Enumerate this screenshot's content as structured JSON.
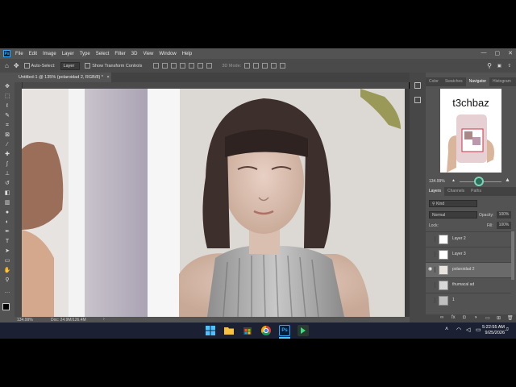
{
  "app": {
    "ps_logo": "Ps",
    "menu": [
      "File",
      "Edit",
      "Image",
      "Layer",
      "Type",
      "Select",
      "Filter",
      "3D",
      "View",
      "Window",
      "Help"
    ],
    "window_controls": [
      "—",
      "▢",
      "✕"
    ]
  },
  "options_bar": {
    "auto_select_label": "Auto-Select:",
    "auto_select_target": "Layer",
    "transform_label": "Show Transform Controls",
    "mode_3d": "3D Mode:"
  },
  "document": {
    "tab_title": "Untitled-1 @ 135% (polaroidad 2, RGB/8) *",
    "tab_close": "×"
  },
  "status_bar": {
    "zoom": "134.99%",
    "doc_size": "Doc: 24.9M/126.4M"
  },
  "navigator": {
    "tabs": [
      "Color",
      "Swatches",
      "Navigator",
      "Histogram"
    ],
    "active_tab": "Navigator",
    "watermark": "t3chbaz",
    "zoom": "134.99%"
  },
  "layers_panel": {
    "tabs": [
      "Layers",
      "Channels",
      "Paths"
    ],
    "active_tab": "Layers",
    "filter_kind": "Kind",
    "blend_mode": "Normal",
    "opacity_label": "Opacity:",
    "opacity_value": "100%",
    "lock_label": "Lock:",
    "fill_label": "Fill:",
    "fill_value": "100%",
    "layers": [
      {
        "name": "Layer 2",
        "visible": false,
        "selected": false
      },
      {
        "name": "Layer 3",
        "visible": false,
        "selected": false
      },
      {
        "name": "polaroidad 2",
        "visible": true,
        "selected": true
      },
      {
        "name": "thumacal ad",
        "visible": false,
        "selected": false
      },
      {
        "name": "1",
        "visible": false,
        "selected": false
      }
    ]
  },
  "taskbar": {
    "time": "5:22:55 AM",
    "date": "9/25/2026"
  }
}
